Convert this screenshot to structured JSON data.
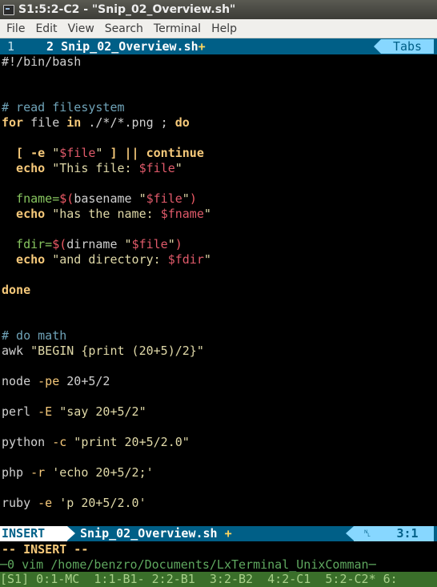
{
  "window": {
    "title": "S1:5:2-C2 - \"Snip_02_Overview.sh\""
  },
  "menu": [
    "File",
    "Edit",
    "View",
    "Search",
    "Terminal",
    "Help"
  ],
  "tabline": {
    "tab1": " 1 ",
    "tab2_num": "2",
    "tab2_name": "Snip_02_Overview.sh",
    "tab2_modified": "+",
    "tabs_label": "Tabs"
  },
  "code": {
    "shebang": "#!/bin/bash",
    "comment_fs": "# read filesystem",
    "for_kw": "for",
    "for_var": " file ",
    "in_kw": "in",
    "for_glob": " ./*/*.png ; ",
    "do_kw": "do",
    "test_open": "  [ ",
    "test_flag": "-e",
    "test_q1": " \"",
    "test_var": "$file",
    "test_q2": "\"",
    "test_close": " ] ",
    "or_op": "||",
    "continue_kw": " continue",
    "echo1_kw": "  echo",
    "echo1_str": " \"This file: ",
    "echo1_var": "$file",
    "echo1_end": "\"",
    "fname_assign": "  fname=",
    "fname_sub_open": "$(",
    "fname_cmd": "basename ",
    "fname_q1": "\"",
    "fname_var": "$file",
    "fname_q2": "\"",
    "fname_sub_close": ")",
    "echo2_kw": "  echo",
    "echo2_str": " \"has the name: ",
    "echo2_var": "$fname",
    "echo2_end": "\"",
    "fdir_assign": "  fdir=",
    "fdir_sub_open": "$(",
    "fdir_cmd": "dirname ",
    "fdir_q1": "\"",
    "fdir_var": "$file",
    "fdir_q2": "\"",
    "fdir_sub_close": ")",
    "echo3_kw": "  echo",
    "echo3_str": " \"and directory: ",
    "echo3_var": "$fdir",
    "echo3_end": "\"",
    "done_kw": "done",
    "comment_math": "# do math",
    "awk_cmd": "awk ",
    "awk_str": "\"BEGIN {print (20+5)/2}\"",
    "node_cmd": "node ",
    "node_flag": "-pe",
    "node_rest": " 20+5/2",
    "perl_cmd": "perl ",
    "perl_flag": "-E",
    "perl_str": " \"say 20+5/2\"",
    "python_cmd": "python ",
    "python_flag": "-c",
    "python_str": " \"print 20+5/2.0\"",
    "php_cmd": "php ",
    "php_flag": "-r",
    "php_str": " 'echo 20+5/2;'",
    "ruby_cmd": "ruby ",
    "ruby_flag": "-e",
    "ruby_str": " 'p 20+5/2.0'"
  },
  "statusline": {
    "mode": "INSERT",
    "filename": "Snip_02_Overview.sh",
    "modified": "+",
    "encoding_icon": "␤",
    "position": "3:1"
  },
  "cmdline": "-- INSERT --",
  "tmux": {
    "title": "─0 vim /home/benzro/Documents/LxTerminal_UnixComman─",
    "windows": "[S1] 0:1-MC  1:1-B1- 2:2-B1  3:2-B2  4:2-C1  5:2-C2* 6:"
  },
  "colors": {
    "titlebar": "#45453f",
    "menubar": "#f0efec",
    "terminal_bg": "#000000",
    "vim_blue": "#005f87",
    "vim_light_blue": "#87d7ff",
    "tmux_green": "#3a6f2a"
  }
}
